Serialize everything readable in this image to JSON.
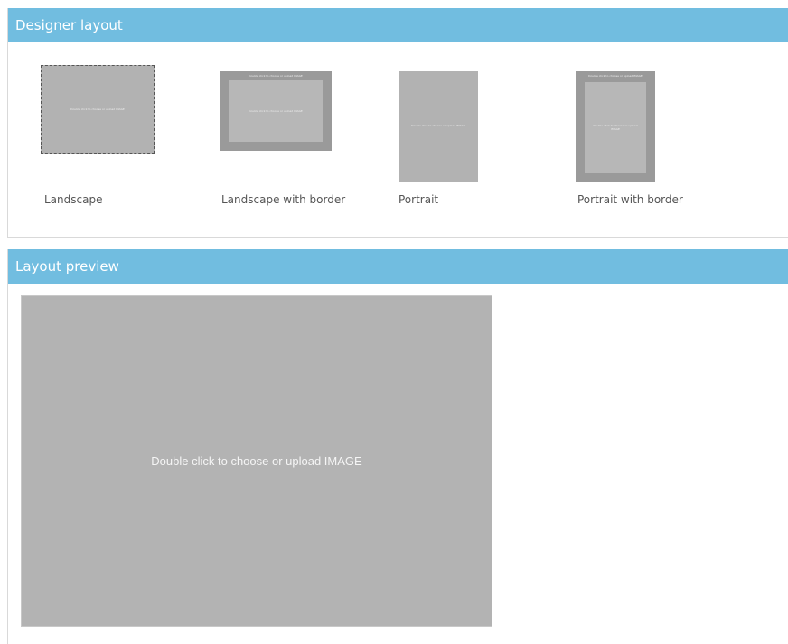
{
  "designer": {
    "title": "Designer layout",
    "layouts": [
      {
        "label": "Landscape",
        "selected": true,
        "thumb_text": "Double click to choose or upload IMAGE"
      },
      {
        "label": "Landscape with border",
        "selected": false,
        "thumb_text": "Double click to choose or upload IMAGE"
      },
      {
        "label": "Portrait",
        "selected": false,
        "thumb_text": "Double click to choose or upload IMAGE"
      },
      {
        "label": "Portrait with border",
        "selected": false,
        "thumb_text": "Double click to choose or upload IMAGE"
      }
    ]
  },
  "preview": {
    "title": "Layout preview",
    "placeholder": "Double click to choose or upload IMAGE"
  },
  "colors": {
    "header_bg": "#71bde0",
    "thumb_fill": "#b2b2b2",
    "border_frame": "#9a9a9a"
  }
}
